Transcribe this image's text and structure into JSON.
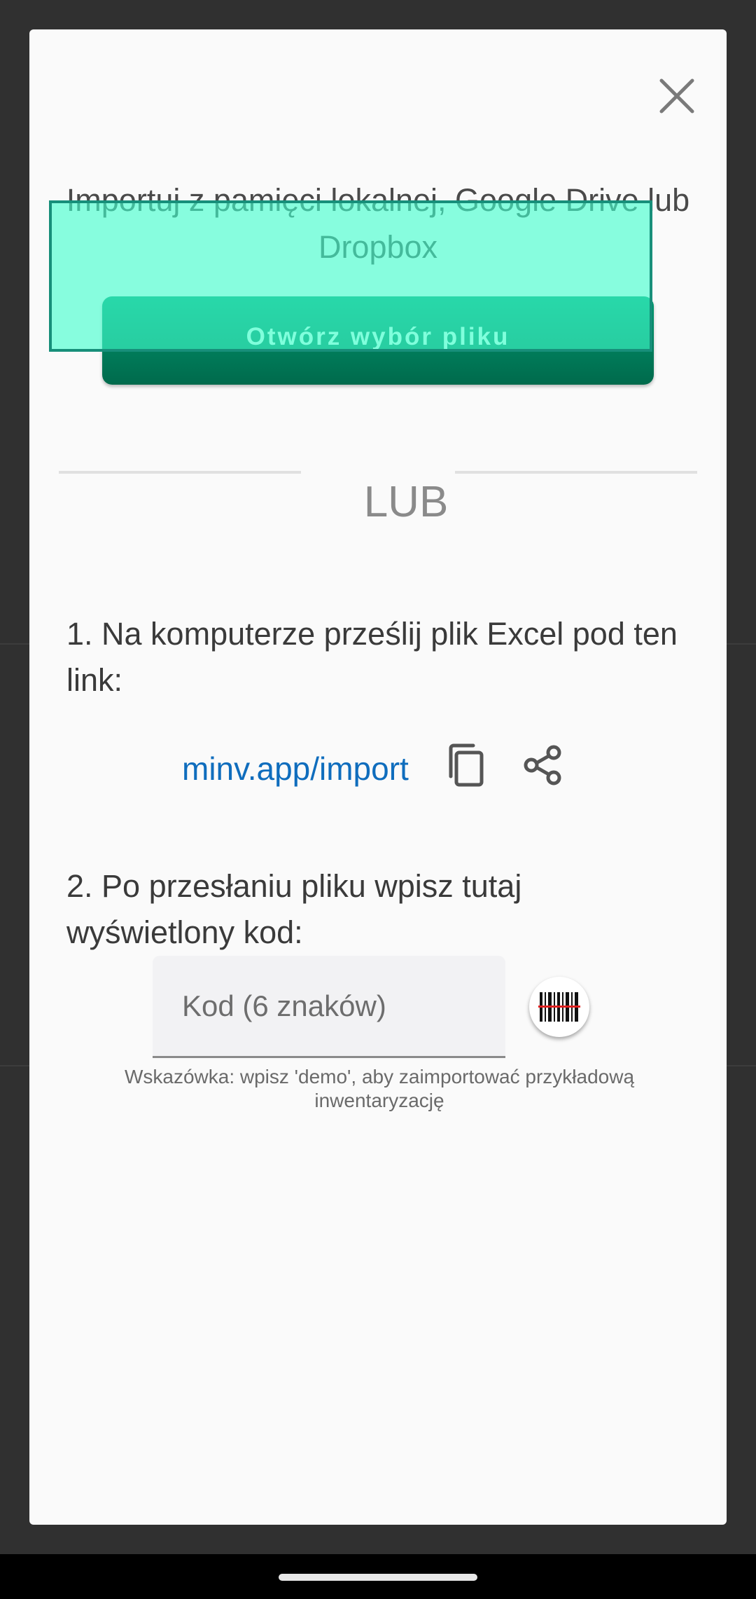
{
  "dialog": {
    "close_icon": "close-icon",
    "import_heading": "Importuj z pamięci lokalnej, Google Drive lub Dropbox",
    "open_file_button": "Otwórz wybór pliku",
    "or_label": "LUB",
    "step1_text": "1. Na komputerze prześlij plik Excel pod ten link:",
    "import_link": "minv.app/import",
    "copy_icon": "copy-icon",
    "share_icon": "share-icon",
    "step2_text": "2. Po przesłaniu pliku wpisz tutaj wyświetlony kod:",
    "code_field": {
      "value": "",
      "placeholder": "Kod (6 znaków)"
    },
    "barcode_icon": "barcode-scanner-icon",
    "hint": "Wskazówka: wpisz 'demo', aby zaimportować przykładową inwentaryzację"
  },
  "colors": {
    "button_green": "#00805d",
    "link_blue": "#0f6dbd",
    "overlay_teal": "#40ffcd"
  }
}
